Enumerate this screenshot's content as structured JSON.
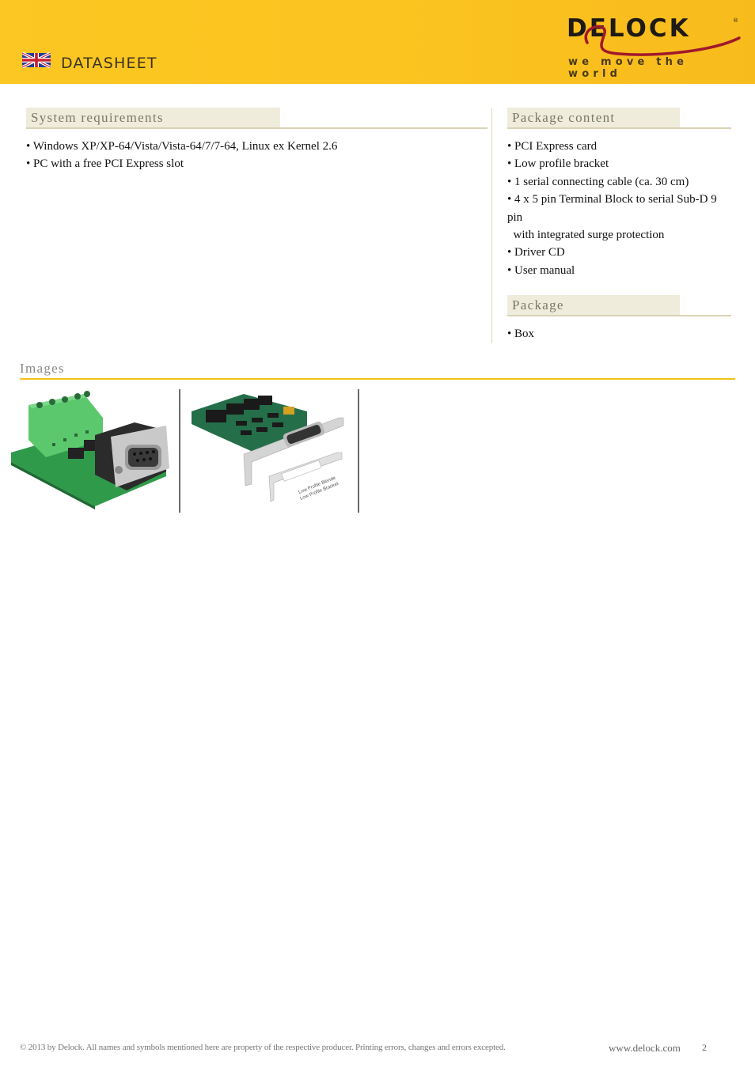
{
  "header": {
    "flag_icon": "uk-flag-icon",
    "label": "DATASHEET",
    "brand": {
      "logo_text": "DELOCK",
      "registered_mark": "®",
      "tagline": "we move the world",
      "colors": {
        "background": "#fcc722",
        "text": "#1e1a14",
        "swoosh": "#a0182c"
      }
    }
  },
  "system_requirements": {
    "title": "System requirements",
    "items": [
      "• Windows XP/XP-64/Vista/Vista-64/7/7-64, Linux ex Kernel 2.6",
      "• PC with a free PCI Express slot"
    ]
  },
  "package_content": {
    "title": "Package content",
    "items": [
      "• PCI Express card",
      "• Low profile bracket",
      "• 1 serial connecting cable (ca. 30 cm)",
      "• 4 x 5 pin Terminal Block to serial Sub-D 9",
      "pin",
      "  with integrated surge protection",
      "• Driver CD",
      "• User manual"
    ]
  },
  "package": {
    "title": "Package",
    "items": [
      "• Box"
    ]
  },
  "images": {
    "title": "Images",
    "items": [
      {
        "name": "terminal-block-adapter-image",
        "alt": "Terminal block to Sub-D 9 adapter"
      },
      {
        "name": "pci-express-card-image",
        "alt": "PCI Express card with low profile bracket",
        "caption_lines": [
          "Low Profile Blende",
          "Low Profile Bracket"
        ]
      }
    ]
  },
  "footer": {
    "copyright": "© 2013 by Delock. All names and symbols mentioned here are property of the respective producer. Printing errors, changes and errors excepted.",
    "url": "www.delock.com",
    "page": "2"
  }
}
